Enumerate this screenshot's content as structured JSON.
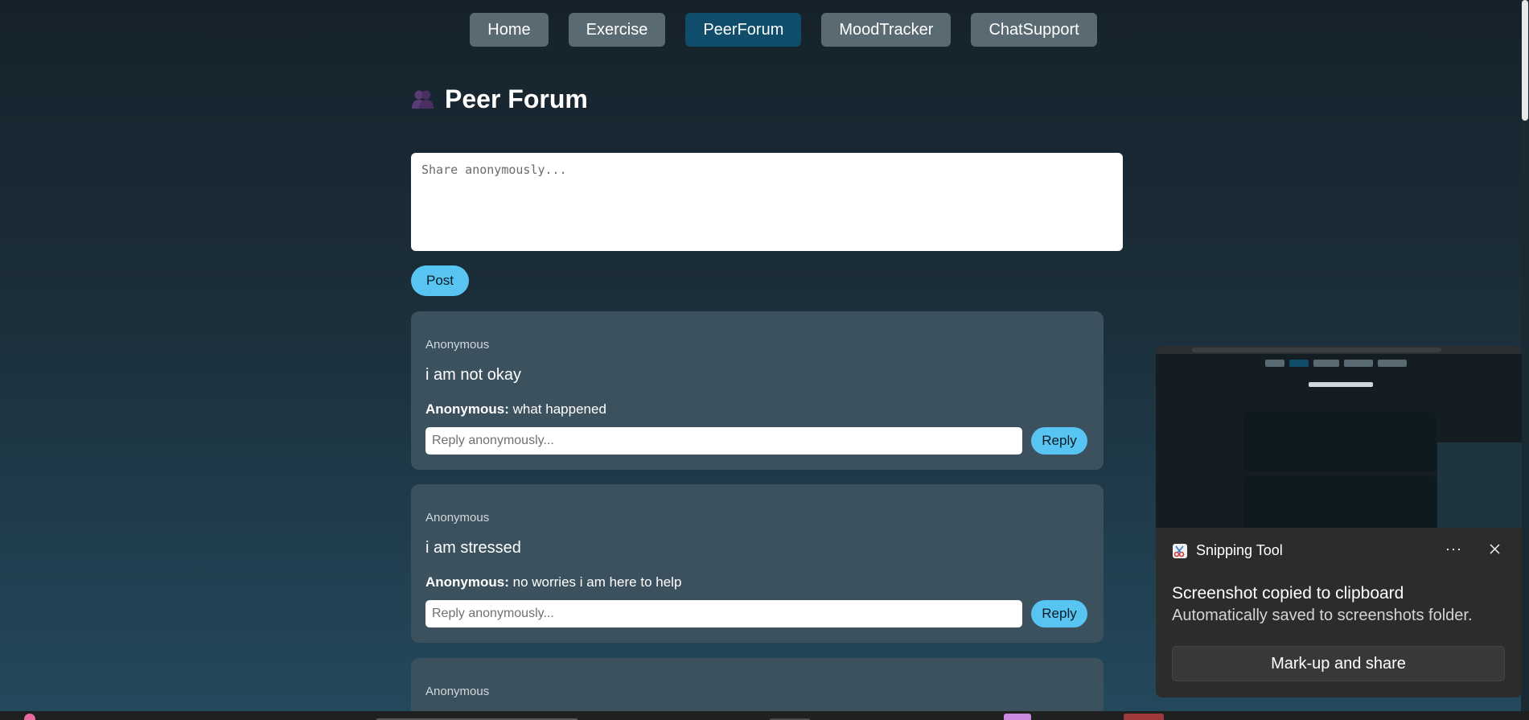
{
  "nav": {
    "items": [
      {
        "label": "Home"
      },
      {
        "label": "Exercise"
      },
      {
        "label": "PeerForum"
      },
      {
        "label": "MoodTracker"
      },
      {
        "label": "ChatSupport"
      }
    ],
    "active": "PeerForum"
  },
  "page": {
    "title": "Peer Forum",
    "title_icon": "busts-in-silhouette-icon"
  },
  "compose": {
    "placeholder": "Share anonymously...",
    "post_label": "Post"
  },
  "posts": [
    {
      "author": "Anonymous",
      "text": "i am not okay",
      "replies": [
        {
          "author": "Anonymous:",
          "text": "what happened"
        }
      ],
      "reply_placeholder": "Reply anonymously...",
      "reply_label": "Reply"
    },
    {
      "author": "Anonymous",
      "text": "i am stressed",
      "replies": [
        {
          "author": "Anonymous:",
          "text": "no worries i am here to help"
        }
      ],
      "reply_placeholder": "Reply anonymously...",
      "reply_label": "Reply"
    },
    {
      "author": "Anonymous"
    }
  ],
  "snipping_tool": {
    "app_name": "Snipping Tool",
    "title": "Screenshot copied to clipboard",
    "subtitle": "Automatically saved to screenshots folder.",
    "action_label": "Mark-up and share",
    "more_label": "···"
  },
  "colors": {
    "accent": "#58c4f2",
    "nav_active": "#0f4d6a",
    "nav_inactive": "#5a6a73",
    "card": "#3b515d"
  }
}
